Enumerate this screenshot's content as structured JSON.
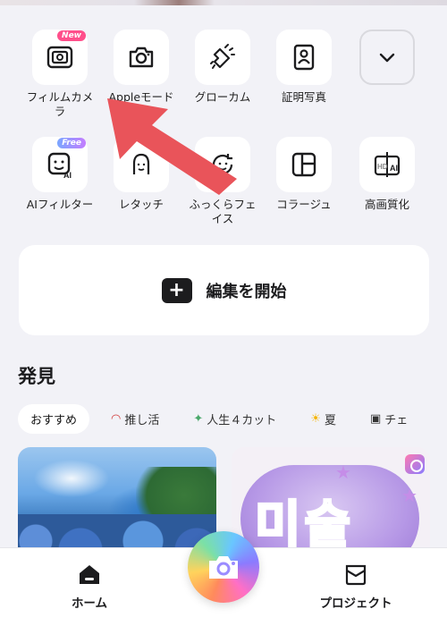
{
  "tools_row1": [
    {
      "label": "フィルムカメラ",
      "badge": "New",
      "icon": "film-camera-icon"
    },
    {
      "label": "Appleモード",
      "icon": "camera-icon"
    },
    {
      "label": "グローカム",
      "icon": "flashlight-icon"
    },
    {
      "label": "証明写真",
      "icon": "id-photo-icon"
    },
    {
      "label": "",
      "icon": "chevron-down-icon"
    }
  ],
  "tools_row2": [
    {
      "label": "AIフィルター",
      "badge": "Free",
      "icon": "ai-face-icon"
    },
    {
      "label": "レタッチ",
      "icon": "retouch-face-icon"
    },
    {
      "label": "ふっくらフェイス",
      "icon": "face-refresh-icon"
    },
    {
      "label": "コラージュ",
      "icon": "collage-icon"
    },
    {
      "label": "高画質化",
      "icon": "hd-ai-icon"
    }
  ],
  "start_edit": {
    "label": "編集を開始",
    "icon": "plus-icon"
  },
  "discover": {
    "title": "発見"
  },
  "chips": [
    {
      "label": "おすすめ",
      "icon": ""
    },
    {
      "label": "推し活",
      "icon": "fan-icon"
    },
    {
      "label": "人生４カット",
      "icon": "fairy-icon"
    },
    {
      "label": "夏",
      "icon": "sun-icon"
    },
    {
      "label": "チェ",
      "icon": "camera-icon"
    }
  ],
  "cards": {
    "right_text": "미술"
  },
  "tabbar": {
    "home": "ホーム",
    "projects": "プロジェクト"
  },
  "colors": {
    "arrow": "#e9545a",
    "background": "#f2f2f7",
    "new_badge": "#ff4f8b"
  }
}
